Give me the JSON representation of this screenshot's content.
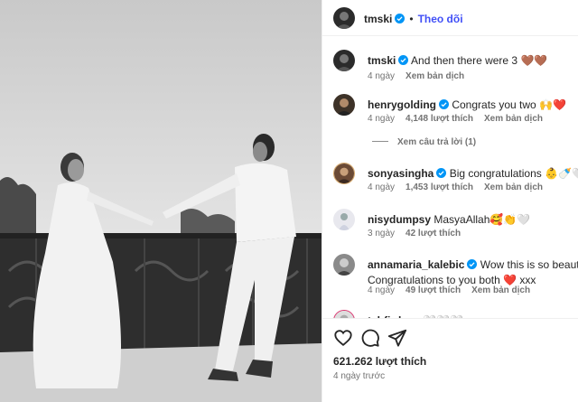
{
  "post": {
    "author": "tmski",
    "follow_label": "Theo dõi",
    "dot": "•",
    "caption_text": "And then there were 3 🤎🤎",
    "caption_time": "4 ngày",
    "caption_translate": "Xem bản dịch",
    "likes": "621.262 lượt thích",
    "posted": "4 ngày trước"
  },
  "comments": [
    {
      "user": "henrygolding",
      "verified": true,
      "text": "Congrats you two 🙌❤️",
      "time": "4 ngày",
      "likes": "4,148 lượt thích",
      "translate": "Xem bản dịch"
    },
    {
      "user": "sonyasingha",
      "verified": true,
      "text": "Big congratulations 👶🍼🤍",
      "time": "4 ngày",
      "likes": "1,453 lượt thích",
      "translate": "Xem bản dịch"
    },
    {
      "user": "nisydumpsy",
      "verified": false,
      "text": "MasyaAllah🥰👏🤍",
      "time": "3 ngày",
      "likes": "42 lượt thích",
      "translate": ""
    },
    {
      "user": "annamaria_kalebic",
      "verified": true,
      "text": "Wow this is so beautiful 🥹",
      "text2": "Congratulations to you both ❤️ xxx",
      "time": "4 ngày",
      "likes": "49 lượt thích",
      "translate": "Xem bản dịch"
    },
    {
      "user": "tehfirdaus",
      "verified": false,
      "text": "🤍🤍🤍",
      "time": "",
      "likes": "",
      "translate": ""
    }
  ],
  "replies_label": "Xem câu trả lời (1)",
  "icons": {
    "like": "heart-icon",
    "comment": "comment-icon",
    "share": "share-icon",
    "verified": "verified-badge-icon"
  },
  "colors": {
    "accent": "#4150f7",
    "verified": "#0095f6",
    "muted": "#737373",
    "text": "#262626"
  }
}
